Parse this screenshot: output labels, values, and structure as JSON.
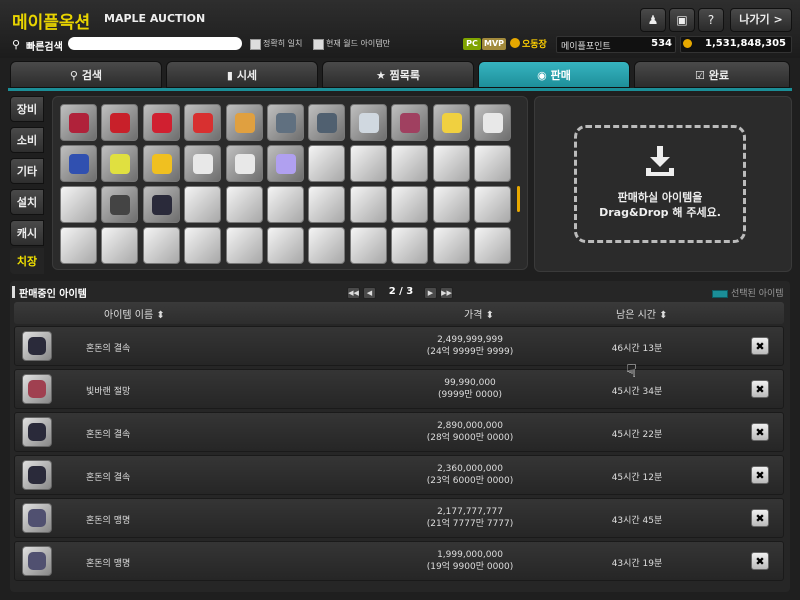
{
  "header": {
    "logo_ko": "메이플옥션",
    "logo_en": "MAPLE AUCTION",
    "user_icon": "user-icon",
    "shop_icon": "box-icon",
    "help_label": "?",
    "exit_label": "나가기 >"
  },
  "search": {
    "label": "빠른검색",
    "placeholder": "",
    "option_exact": "정확히 일치",
    "option_world": "현재 월드 아이템만"
  },
  "account": {
    "badge_pc": "PC",
    "badge_mvp": "MVP",
    "world": "오동장",
    "maple_point_label": "메이플포인트",
    "maple_point_value": "534",
    "meso_value": "1,531,848,305"
  },
  "tabs": [
    {
      "icon": "search-icon",
      "label": "검색"
    },
    {
      "icon": "chart-icon",
      "label": "시세"
    },
    {
      "icon": "star-icon",
      "label": "찜목록"
    },
    {
      "icon": "coin-icon",
      "label": "판매"
    },
    {
      "icon": "check-icon",
      "label": "완료"
    }
  ],
  "active_tab": "판매",
  "side_tabs": [
    "장비",
    "소비",
    "기타",
    "설치",
    "캐시",
    "치장"
  ],
  "active_side_tab": "치장",
  "inventory_colors": [
    "#b0223a",
    "#c8202a",
    "#d02030",
    "#d83030",
    "#e0a040",
    "#607080",
    "#506070",
    "#d0d8e0",
    "#a04060",
    "#f0d040",
    "#e8e8e8",
    "#3050b0",
    "#e0e040",
    "#f0c020",
    "#e8e8e8",
    "#e8e8e8",
    "#b0a0f0",
    "",
    "",
    "",
    "",
    "",
    "",
    "#444",
    "#2a2a3a",
    "",
    "",
    "",
    "",
    "",
    "",
    "",
    "",
    "",
    "",
    "",
    "",
    "",
    "",
    "",
    "",
    "",
    "",
    "",
    ""
  ],
  "drop": {
    "text_line1": "판매하실 아이템을",
    "text_line2": "Drag&Drop 해 주세요."
  },
  "list": {
    "title": "판매중인 아이템",
    "page": "2 / 3",
    "legend": "선택된 아이템",
    "col_name": "아이템 이름 ⬍",
    "col_price": "가격 ⬍",
    "col_time": "남은 시간 ⬍",
    "delete_label": "✖",
    "items": [
      {
        "name": "혼돈의 결속",
        "price": "2,499,999,999",
        "price_note": "(24억 9999만 9999)",
        "time": "46시간 13분",
        "color": "#2a2a3a"
      },
      {
        "name": "빛바랜 절망",
        "price": "99,990,000",
        "price_note": "(9999만 0000)",
        "time": "45시간 34분",
        "color": "#a04050"
      },
      {
        "name": "혼돈의 결속",
        "price": "2,890,000,000",
        "price_note": "(28억 9000만 0000)",
        "time": "45시간 22분",
        "color": "#2a2a3a"
      },
      {
        "name": "혼돈의 결속",
        "price": "2,360,000,000",
        "price_note": "(23억 6000만 0000)",
        "time": "45시간 12분",
        "color": "#2a2a3a"
      },
      {
        "name": "혼돈의 맹명",
        "price": "2,177,777,777",
        "price_note": "(21억 7777만 7777)",
        "time": "43시간 45분",
        "color": "#505070"
      },
      {
        "name": "혼돈의 맹명",
        "price": "1,999,000,000",
        "price_note": "(19억 9900만 0000)",
        "time": "43시간 19분",
        "color": "#505070"
      }
    ]
  }
}
